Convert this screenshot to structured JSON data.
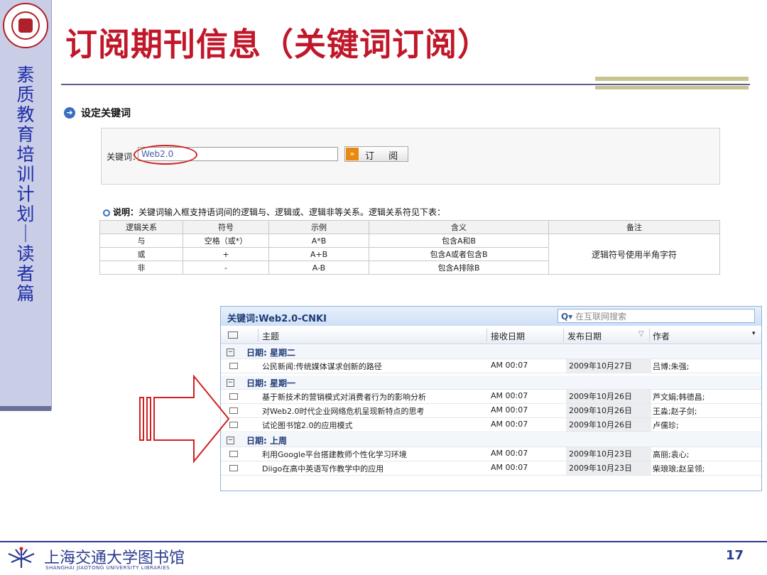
{
  "slide": {
    "title": "订阅期刊信息（关键词订阅）",
    "vertical_title": "素质教育培训计划｜读者篇",
    "page_number": "17"
  },
  "keyword_panel": {
    "header": "设定关键词",
    "label": "关键词：",
    "input_value": "Web2.0",
    "subscribe_label": "订 阅",
    "note_bold": "说明：",
    "note_text": "关键词输入框支持语词间的逻辑与、逻辑或、逻辑非等关系。逻辑关系符见下表："
  },
  "rules_table": {
    "headers": [
      "逻辑关系",
      "符号",
      "示例",
      "含义",
      "备注"
    ],
    "rows": [
      [
        "与",
        "空格（或*）",
        "A*B",
        "包含A和B"
      ],
      [
        "或",
        "+",
        "A+B",
        "包含A或者包含B"
      ],
      [
        "非",
        "-",
        "A-B",
        "包含A排除B"
      ]
    ],
    "remark": "逻辑符号使用半角字符"
  },
  "mail": {
    "title": "关键词:Web2.0-CNKI",
    "search_placeholder": "在互联网搜索",
    "columns": {
      "subject": "主题",
      "received": "接收日期",
      "published": "发布日期",
      "author": "作者"
    },
    "groups": [
      {
        "label": "日期: 星期二",
        "items": [
          {
            "subject": "公民新闻:传统媒体谋求创新的路径",
            "received": "AM 00:07",
            "published": "2009年10月27日",
            "author": "吕博;朱强;"
          }
        ]
      },
      {
        "label": "日期: 星期一",
        "items": [
          {
            "subject": "基于新技术的营销模式对消费者行为的影响分析",
            "received": "AM 00:07",
            "published": "2009年10月26日",
            "author": "芦文娟;韩德昌;"
          },
          {
            "subject": "对Web2.0时代企业网络危机呈现新特点的思考",
            "received": "AM 00:07",
            "published": "2009年10月26日",
            "author": "王淼;赵子剑;"
          },
          {
            "subject": "试论图书馆2.0的应用模式",
            "received": "AM 00:07",
            "published": "2009年10月26日",
            "author": "卢儒珍;"
          }
        ]
      },
      {
        "label": "日期: 上周",
        "items": [
          {
            "subject": "利用Google平台搭建教师个性化学习环境",
            "received": "AM 00:07",
            "published": "2009年10月23日",
            "author": "高丽;袁心;"
          },
          {
            "subject": "Diigo在高中英语写作教学中的应用",
            "received": "AM 00:07",
            "published": "2009年10月23日",
            "author": "柴琅琅;赵呈领;"
          }
        ]
      }
    ]
  },
  "footer": {
    "library_cn": "上海交通大学图书馆",
    "library_en": "SHANGHAI JIAOTONG UNIVERSITY LIBRARIES"
  },
  "colors": {
    "title": "#c0182a",
    "accent_blue": "#2b3a8f",
    "highlight_red": "#d02020"
  }
}
